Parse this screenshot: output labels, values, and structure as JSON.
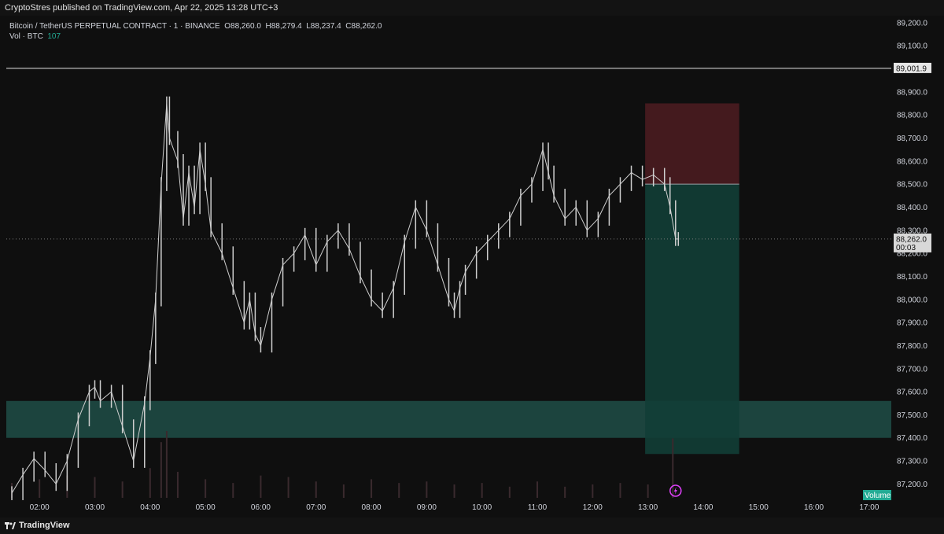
{
  "header": {
    "published": "CryptoStres published on TradingView.com, Apr 22, 2025 13:28 UTC+3"
  },
  "legend": {
    "symbol": "Bitcoin / TetherUS PERPETUAL CONTRACT · 1 · BINANCE",
    "open": "O88,260.0",
    "high": "H88,279.4",
    "low": "L88,237.4",
    "close": "C88,262.0",
    "vol_label": "Vol · BTC",
    "vol_value": "107"
  },
  "footer": {
    "brand": "TradingView"
  },
  "chart_data": {
    "type": "line",
    "ylim": [
      87140,
      89230
    ],
    "y_ticks": [
      87200,
      87300,
      87400,
      87500,
      87600,
      87700,
      87800,
      87900,
      88000,
      88100,
      88200,
      88300,
      88400,
      88500,
      88600,
      88700,
      88800,
      88900,
      89000,
      89100,
      89200
    ],
    "y_tick_labels": [
      "87,200.0",
      "87,300.0",
      "87,400.0",
      "87,500.0",
      "87,600.0",
      "87,700.0",
      "87,800.0",
      "87,900.0",
      "88,000.0",
      "88,100.0",
      "88,200.0",
      "88,300.0",
      "88,400.0",
      "88,500.0",
      "88,600.0",
      "88,700.0",
      "88,800.0",
      "88,900.0",
      "89,000.0",
      "89,100.0",
      "89,200.0"
    ],
    "x_ticks": [
      "02:00",
      "03:00",
      "04:00",
      "05:00",
      "06:00",
      "07:00",
      "08:00",
      "09:00",
      "10:00",
      "11:00",
      "12:00",
      "13:00",
      "14:00",
      "15:00",
      "16:00",
      "17:00"
    ],
    "xlim_hours": [
      1.4,
      17.4
    ],
    "price_series": {
      "time_hours": [
        1.5,
        1.7,
        1.9,
        2.1,
        2.3,
        2.5,
        2.7,
        2.9,
        3.0,
        3.1,
        3.3,
        3.5,
        3.7,
        3.9,
        4.0,
        4.1,
        4.2,
        4.3,
        4.35,
        4.5,
        4.6,
        4.7,
        4.8,
        4.9,
        5.0,
        5.1,
        5.3,
        5.5,
        5.7,
        5.8,
        5.9,
        6.0,
        6.2,
        6.4,
        6.6,
        6.8,
        7.0,
        7.2,
        7.4,
        7.6,
        7.8,
        8.0,
        8.2,
        8.4,
        8.6,
        8.8,
        9.0,
        9.2,
        9.4,
        9.5,
        9.6,
        9.7,
        9.9,
        10.1,
        10.3,
        10.5,
        10.7,
        10.9,
        11.1,
        11.2,
        11.3,
        11.5,
        11.7,
        11.9,
        12.1,
        12.3,
        12.5,
        12.7,
        12.9,
        13.1,
        13.3,
        13.4,
        13.5,
        13.55
      ],
      "close": [
        87160,
        87240,
        87310,
        87260,
        87200,
        87300,
        87480,
        87600,
        87620,
        87560,
        87600,
        87450,
        87300,
        87550,
        87750,
        88000,
        88500,
        88850,
        88700,
        88600,
        88350,
        88550,
        88400,
        88650,
        88500,
        88300,
        88200,
        88050,
        87900,
        88000,
        87850,
        87800,
        88000,
        88150,
        88200,
        88280,
        88150,
        88250,
        88300,
        88220,
        88100,
        88000,
        87950,
        88050,
        88250,
        88400,
        88300,
        88150,
        88000,
        87950,
        88050,
        88120,
        88200,
        88250,
        88300,
        88350,
        88450,
        88500,
        88650,
        88550,
        88450,
        88350,
        88400,
        88300,
        88350,
        88450,
        88500,
        88550,
        88520,
        88540,
        88500,
        88400,
        88262,
        88262
      ]
    },
    "volume_series": {
      "time_hours": [
        1.5,
        2.0,
        2.5,
        3.0,
        3.5,
        4.0,
        4.2,
        4.3,
        4.5,
        5.0,
        5.5,
        6.0,
        6.5,
        7.0,
        7.5,
        8.0,
        8.5,
        9.0,
        9.5,
        10.0,
        10.5,
        11.0,
        11.5,
        12.0,
        12.5,
        13.0,
        13.45
      ],
      "volume": [
        20,
        25,
        30,
        28,
        22,
        40,
        75,
        90,
        35,
        25,
        20,
        30,
        28,
        22,
        18,
        25,
        20,
        22,
        18,
        20,
        15,
        22,
        15,
        18,
        20,
        18,
        80
      ]
    },
    "horizontal_line": {
      "price": 89001.9,
      "label": "89,001.9"
    },
    "current_price": {
      "price": 88262.0,
      "label": "88,262.0",
      "countdown": "00:03"
    },
    "position": {
      "start_hours": 12.95,
      "end_hours": 14.65,
      "entry": 88500,
      "stop": 88850,
      "target": 87330
    },
    "zone": {
      "top": 87560,
      "bottom": 87400
    },
    "volume_label": "Volume",
    "colors": {
      "background": "#0f0f0f",
      "candles": "#cfcfcf",
      "zone": "#1e4e47",
      "position_profit": "#123e36",
      "position_loss": "#4a1c20",
      "line": "#e6e6e6",
      "volume": "#3a2a2e",
      "accent": "#22ab94"
    }
  }
}
